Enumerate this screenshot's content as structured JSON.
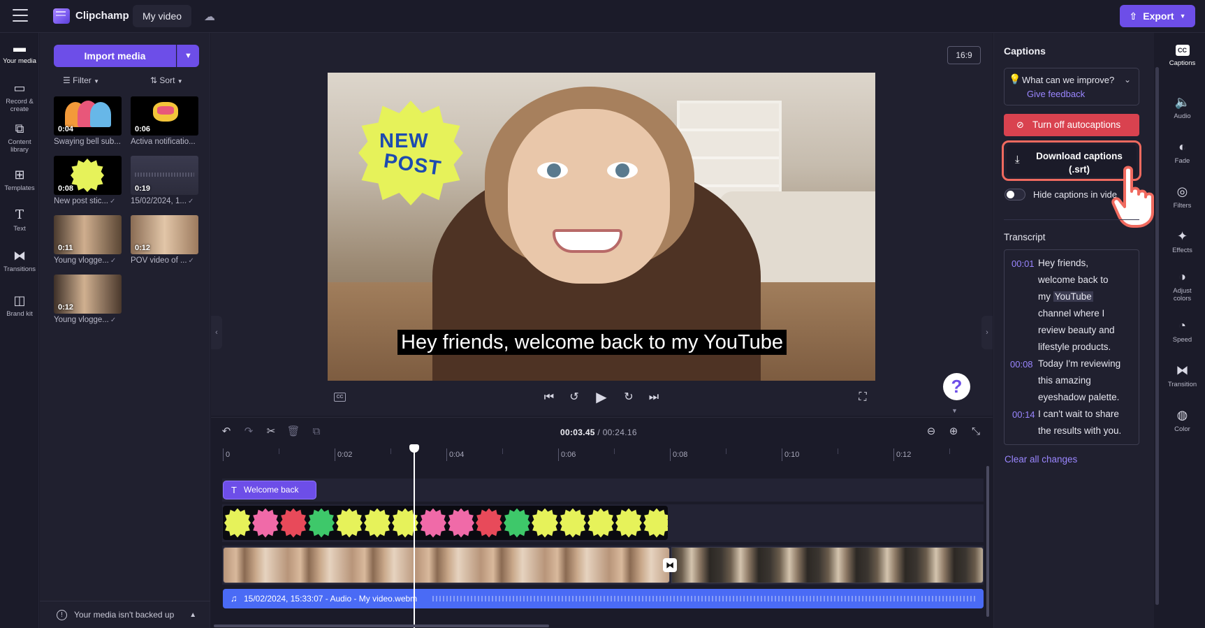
{
  "topbar": {
    "app_name": "Clipchamp",
    "project_name": "My video",
    "export_label": "Export"
  },
  "left_nav": [
    {
      "label": "Your media",
      "icon": "folder-icon"
    },
    {
      "label": "Record & create",
      "icon": "camera-icon"
    },
    {
      "label": "Content library",
      "icon": "library-icon"
    },
    {
      "label": "Templates",
      "icon": "templates-icon"
    },
    {
      "label": "Text",
      "icon": "text-icon"
    },
    {
      "label": "Transitions",
      "icon": "transitions-icon"
    },
    {
      "label": "Brand kit",
      "icon": "brand-kit-icon"
    }
  ],
  "media": {
    "import_label": "Import media",
    "filter_label": "Filter",
    "sort_label": "Sort",
    "items": [
      {
        "duration": "0:04",
        "label": "Swaying bell sub...",
        "checked": false
      },
      {
        "duration": "0:06",
        "label": "Activa notificatio...",
        "checked": false
      },
      {
        "duration": "0:08",
        "label": "New post stic...",
        "checked": true
      },
      {
        "duration": "0:19",
        "label": "15/02/2024, 1...",
        "checked": true
      },
      {
        "duration": "0:11",
        "label": "Young vlogge...",
        "checked": true
      },
      {
        "duration": "0:12",
        "label": "POV video of ...",
        "checked": true
      },
      {
        "duration": "0:12",
        "label": "Young vlogge...",
        "checked": true
      }
    ],
    "backup_notice": "Your media isn't backed up"
  },
  "preview": {
    "aspect_ratio": "16:9",
    "caption": "Hey friends, welcome back to my YouTube",
    "sticker_text_1": "NEW",
    "sticker_text_2": "POST",
    "help": "?"
  },
  "timeline": {
    "current_time": "00:03.45",
    "total_time": "/ 00:24.16",
    "ticks": [
      "0",
      "0:02",
      "0:04",
      "0:06",
      "0:08",
      "0:10",
      "0:12"
    ],
    "text_clip_label": "Welcome back",
    "audio_clip_label": "15/02/2024, 15:33:07 - Audio - My video.webm"
  },
  "captions": {
    "title": "Captions",
    "feedback_question": "What can we improve?",
    "give_feedback": "Give feedback",
    "turn_off_label": "Turn off autocaptions",
    "download_line1": "Download captions",
    "download_line2": "(.srt)",
    "hide_label": "Hide captions in video",
    "transcript_title": "Transcript",
    "transcript": [
      {
        "time": "00:01",
        "lines": [
          "Hey friends,",
          "welcome back to",
          "my ",
          "channel where I",
          "review beauty and",
          "lifestyle products."
        ],
        "highlight": "YouTube"
      },
      {
        "time": "00:08",
        "lines": [
          "Today I'm reviewing",
          "this amazing",
          "eyeshadow palette."
        ]
      },
      {
        "time": "00:14",
        "lines": [
          "I can't wait to share",
          "the results with you."
        ]
      }
    ],
    "clear_changes": "Clear all changes"
  },
  "right_tools": [
    {
      "label": "Captions",
      "icon": "captions-icon"
    },
    {
      "label": "Audio",
      "icon": "speaker-icon"
    },
    {
      "label": "Fade",
      "icon": "fade-icon"
    },
    {
      "label": "Filters",
      "icon": "filters-icon"
    },
    {
      "label": "Effects",
      "icon": "effects-icon"
    },
    {
      "label": "Adjust colors",
      "icon": "adjust-colors-icon"
    },
    {
      "label": "Speed",
      "icon": "speed-icon"
    },
    {
      "label": "Transition",
      "icon": "transition-icon"
    },
    {
      "label": "Color",
      "icon": "color-icon"
    }
  ],
  "colors": {
    "accent": "#6d4ee8",
    "danger": "#d9424f",
    "highlight_ring": "#f06a5f",
    "audio_track": "#4a6bf5"
  }
}
